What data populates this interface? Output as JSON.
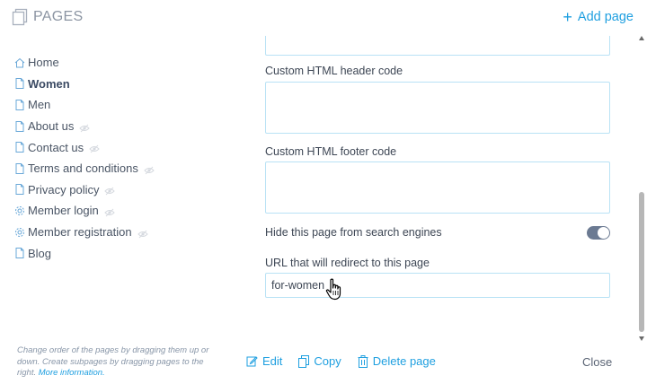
{
  "header": {
    "title": "PAGES",
    "add_page_label": "Add page"
  },
  "sidebar": {
    "items": [
      {
        "label": "Home",
        "icon": "home-icon",
        "hidden": false,
        "active": false
      },
      {
        "label": "Women",
        "icon": "page-icon",
        "hidden": false,
        "active": true
      },
      {
        "label": "Men",
        "icon": "page-icon",
        "hidden": false,
        "active": false
      },
      {
        "label": "About us",
        "icon": "page-icon",
        "hidden": true,
        "active": false
      },
      {
        "label": "Contact us",
        "icon": "page-icon",
        "hidden": true,
        "active": false
      },
      {
        "label": "Terms and conditions",
        "icon": "page-icon",
        "hidden": true,
        "active": false
      },
      {
        "label": "Privacy policy",
        "icon": "page-icon",
        "hidden": true,
        "active": false
      },
      {
        "label": "Member login",
        "icon": "gear-icon",
        "hidden": true,
        "active": false
      },
      {
        "label": "Member registration",
        "icon": "gear-icon",
        "hidden": true,
        "active": false
      },
      {
        "label": "Blog",
        "icon": "page-icon",
        "hidden": false,
        "active": false
      }
    ],
    "footer_text": "Change order of the pages by dragging them up or down. Create subpages by dragging pages to the right.",
    "footer_link": "More information."
  },
  "form": {
    "header_code_label": "Custom HTML header code",
    "header_code_value": "",
    "footer_code_label": "Custom HTML footer code",
    "footer_code_value": "",
    "hide_search_label": "Hide this page from search engines",
    "hide_search_enabled": true,
    "redirect_label": "URL that will redirect to this page",
    "redirect_value": "for-women"
  },
  "actions": {
    "edit_label": "Edit",
    "copy_label": "Copy",
    "delete_label": "Delete page",
    "close_label": "Close"
  },
  "colors": {
    "accent": "#1e9fe0",
    "input_border": "#b9e2f5",
    "toggle_on": "#6b7a92",
    "text": "#3d4654",
    "muted": "#8c95a3"
  }
}
